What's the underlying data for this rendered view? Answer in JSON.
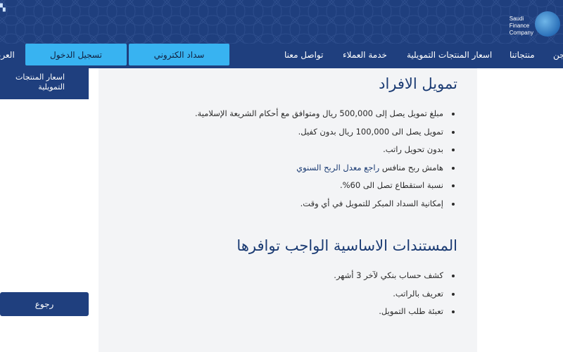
{
  "brand": {
    "logo_line1": "Saudi",
    "logo_line2": "Finance",
    "logo_line3": "Company"
  },
  "nav": {
    "items": [
      {
        "label": "العربية"
      },
      {
        "label": "منتجاتنا"
      },
      {
        "label": "اسعار المنتجات التمويلية"
      },
      {
        "label": "خدمة العملاء"
      },
      {
        "label": "تواصل معنا"
      }
    ],
    "partial_right_label": "جن",
    "pay_button": "سداد الكتروني",
    "login_button": "تسجيل الدخول"
  },
  "sidebar": {
    "prices_label": "اسعار المنتجات التمويلية",
    "back_label": "رجوع"
  },
  "main": {
    "section1_title": "تمويل الافراد",
    "section1_items": [
      "مبلغ تمويل يصل إلى 500,000 ريال ومتوافق مع أحكام الشريعة الإسلامية.",
      "تمويل يصل الى 100,000 ريال بدون كفيل.",
      "بدون تحويل راتب.",
      "هامش ربح منافس",
      "نسبة استقطاع تصل الى 60%.",
      "إمكانية السداد المبكر للتمويل في أي وقت."
    ],
    "profit_link": "راجع معدل الربح السنوي",
    "section2_title": "المستندات الاساسية الواجب توافرها",
    "section2_items": [
      "كشف حساب بنكي لآخر 3 أشهر.",
      "تعريف بالراتب.",
      "تعبئة طلب التمويل."
    ]
  },
  "colors": {
    "header_bg": "#1f3f7e",
    "button_bg": "#38b3f1",
    "title_color": "#1b3b73",
    "content_bg": "#f3f4f6"
  }
}
